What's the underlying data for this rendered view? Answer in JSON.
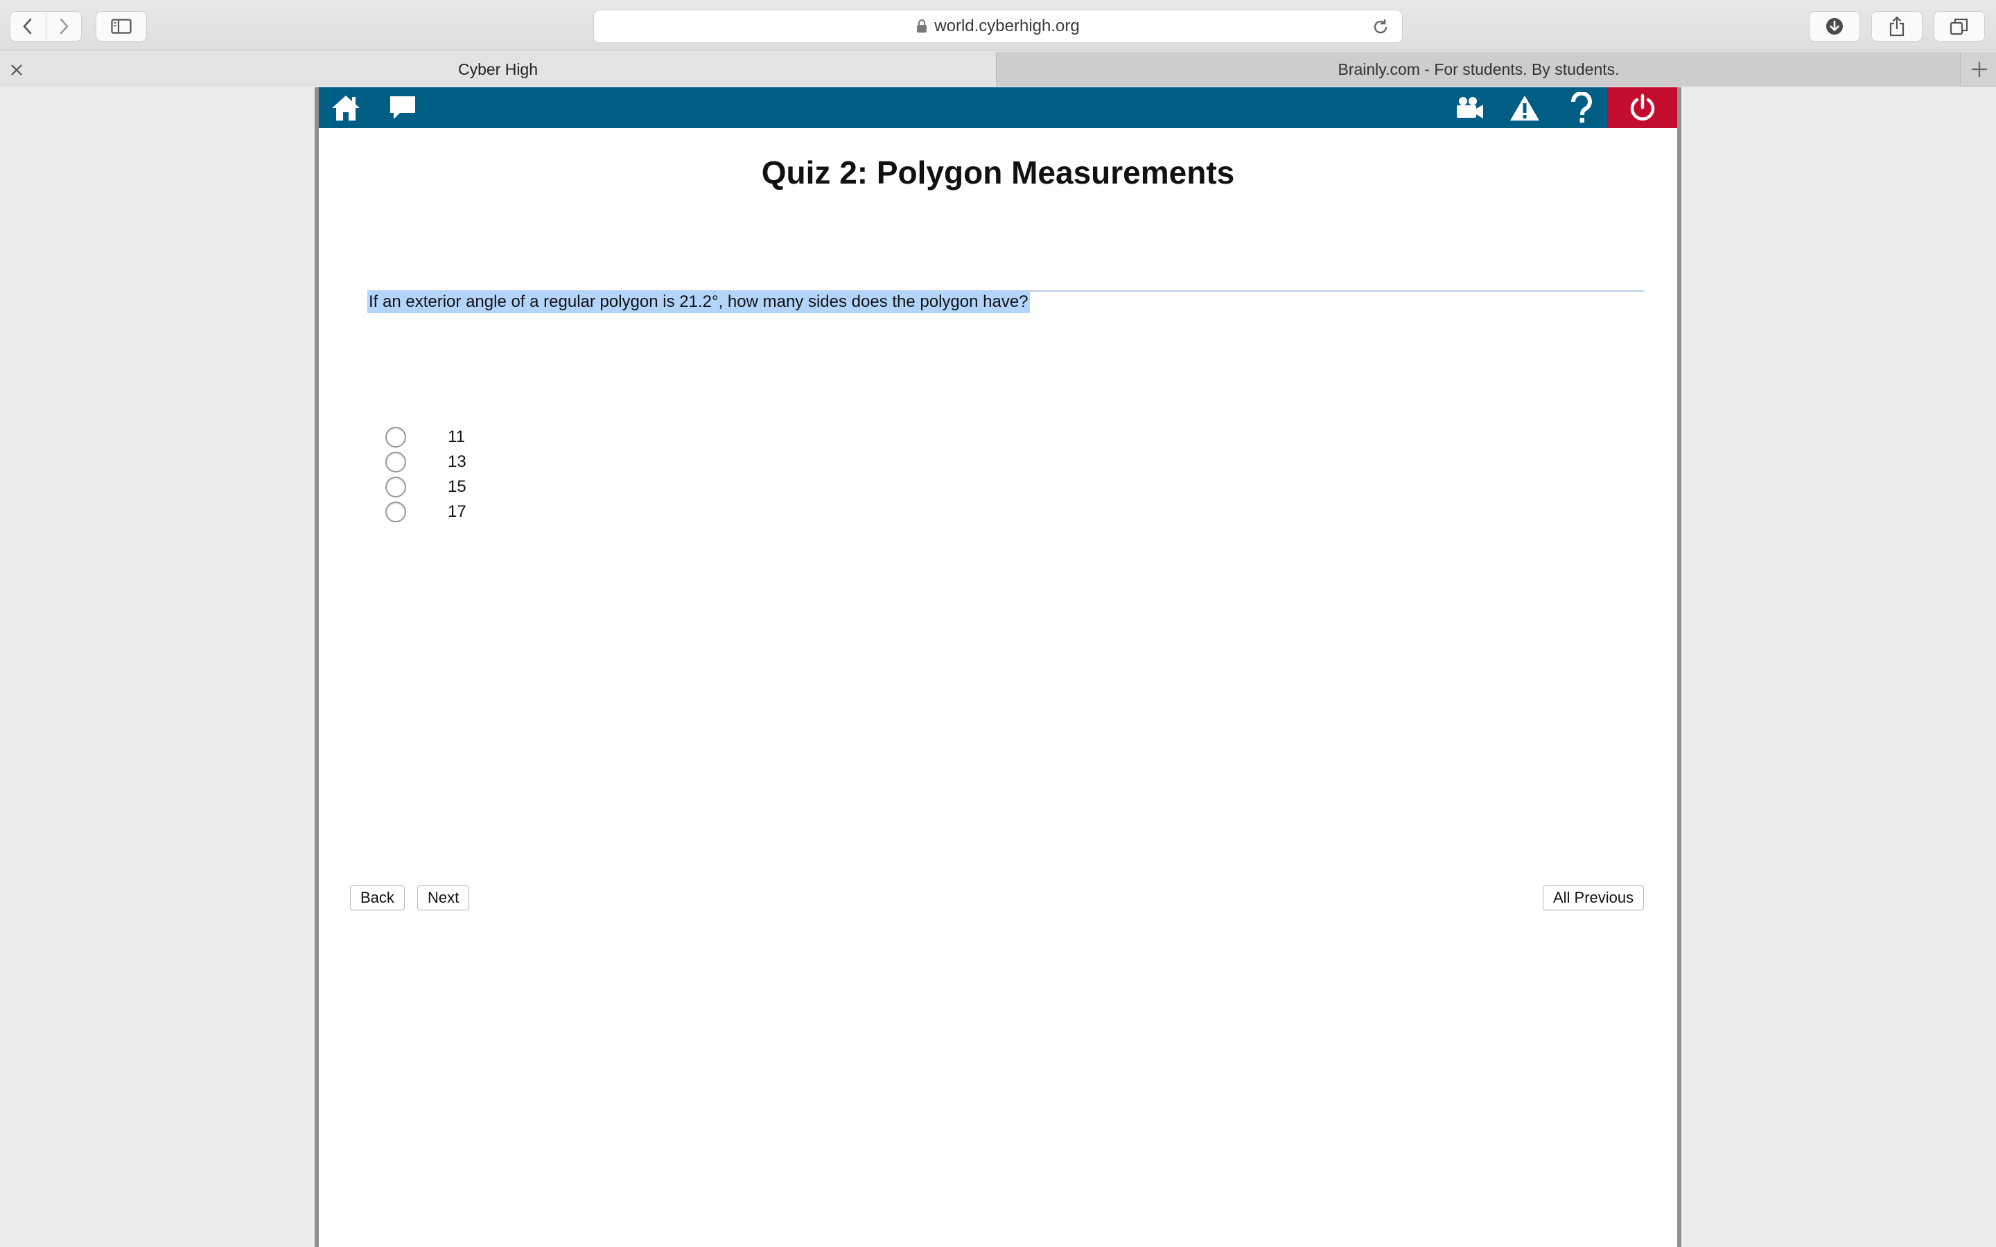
{
  "browser": {
    "url": "world.cyberhigh.org",
    "tabs": [
      {
        "label": "Cyber High",
        "active": true
      },
      {
        "label": "Brainly.com - For students. By students.",
        "active": false
      }
    ]
  },
  "colors": {
    "app_bar": "#005e85",
    "power_button": "#c20d2f",
    "selection_highlight": "#b4d5fb"
  },
  "icons": {
    "app_bar_left": [
      "home-icon",
      "chat-bubble-icon"
    ],
    "app_bar_right": [
      "video-camera-icon",
      "warning-icon",
      "help-icon",
      "power-icon"
    ]
  },
  "quiz": {
    "title": "Quiz 2: Polygon Measurements",
    "question": "If an exterior angle of a regular polygon is 21.2°, how many sides does the polygon have?",
    "options": [
      "11",
      "13",
      "15",
      "17"
    ]
  },
  "buttons": {
    "back": "Back",
    "next": "Next",
    "all_previous": "All Previous"
  }
}
